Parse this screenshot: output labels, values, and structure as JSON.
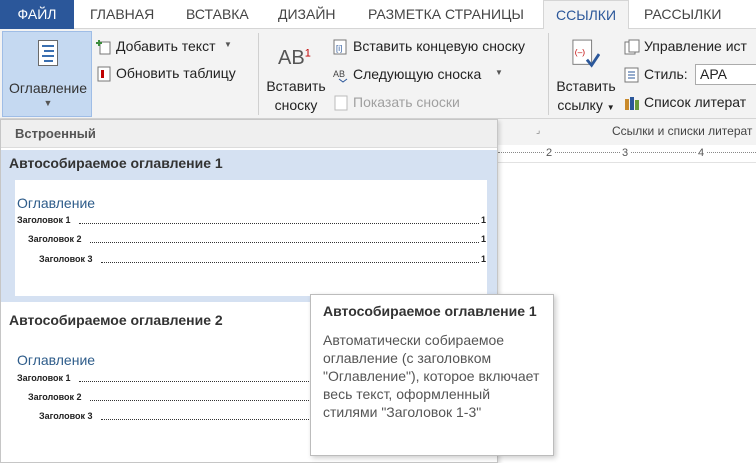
{
  "tabs": [
    "ФАЙЛ",
    "ГЛАВНАЯ",
    "ВСТАВКА",
    "ДИЗАЙН",
    "РАЗМЕТКА СТРАНИЦЫ",
    "ССЫЛКИ",
    "РАССЫЛКИ"
  ],
  "ribbon": {
    "toc_button": "Оглавление",
    "add_text": "Добавить текст",
    "update_table": "Обновить таблицу",
    "insert_footnote_line1": "Вставить",
    "insert_footnote_line2": "сноску",
    "footnote_icon_text": "AB",
    "footnote_superscript": "1",
    "insert_endnote": "Вставить концевую сноску",
    "next_footnote": "Следующую сноска",
    "show_notes": "Показать сноски",
    "insert_citation_line1": "Вставить",
    "insert_citation_line2": "ссылку",
    "manage_sources": "Управление ист",
    "style_label": "Стиль:",
    "style_value": "APA",
    "bibliography": "Список литерат",
    "group_citations": "Ссылки и списки литерат"
  },
  "ruler": [
    "2",
    "3",
    "4"
  ],
  "gallery": {
    "section_label": "Встроенный",
    "entries": [
      {
        "title": "Автособираемое оглавление 1",
        "preview_heading": "Оглавление",
        "lines": [
          "Заголовок 1",
          "Заголовок 2",
          "Заголовок 3"
        ],
        "page": "1"
      },
      {
        "title": "Автособираемое оглавление 2",
        "preview_heading": "Оглавление",
        "lines": [
          "Заголовок 1",
          "Заголовок 2",
          "Заголовок 3"
        ]
      }
    ]
  },
  "tooltip": {
    "title": "Автособираемое оглавление 1",
    "body": "Автоматически собираемое оглавление (с заголовком \"Оглавление\"), которое включает весь текст, оформленный стилями \"Заголовок 1-3\""
  }
}
